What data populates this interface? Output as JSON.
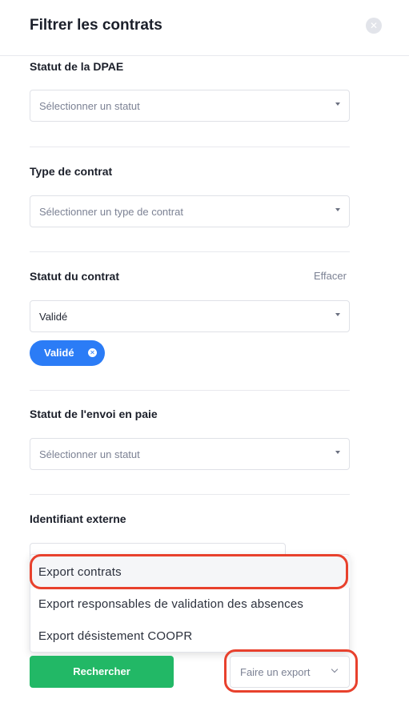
{
  "panel": {
    "title": "Filtrer les contrats",
    "close_icon": "close-circle-icon"
  },
  "filters": {
    "dpae": {
      "label": "Statut de la DPAE",
      "placeholder": "Sélectionner un statut"
    },
    "contract_type": {
      "label": "Type de contrat",
      "placeholder": "Sélectionner un type de contrat"
    },
    "contract_status": {
      "label": "Statut du contrat",
      "clear_label": "Effacer",
      "value": "Validé",
      "chips": [
        {
          "label": "Validé"
        }
      ]
    },
    "payroll_status": {
      "label": "Statut de l'envoi en paie",
      "placeholder": "Sélectionner un statut"
    },
    "external_id": {
      "label": "Identifiant externe",
      "value": ""
    }
  },
  "export_menu": {
    "items": [
      {
        "label": "Export contrats"
      },
      {
        "label": "Export responsables de validation des absences"
      },
      {
        "label": "Export désistement COOPR"
      }
    ]
  },
  "footer": {
    "search_label": "Rechercher",
    "export_label": "Faire un export"
  },
  "colors": {
    "chip": "#2b7cf6",
    "search_button": "#22b866",
    "highlight": "#e8412d"
  }
}
